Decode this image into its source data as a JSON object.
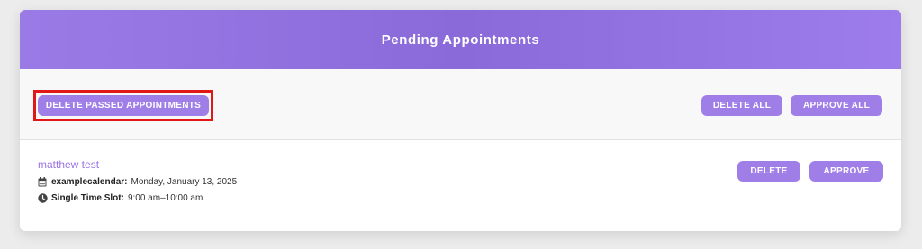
{
  "panel": {
    "title": "Pending Appointments"
  },
  "toolbar": {
    "delete_passed_label": "DELETE PASSED APPOINTMENTS",
    "delete_all_label": "DELETE ALL",
    "approve_all_label": "APPROVE ALL"
  },
  "appointments": [
    {
      "name": "matthew test",
      "calendar_label": "examplecalendar:",
      "date": "Monday, January 13, 2025",
      "slot_label": "Single Time Slot:",
      "time": "9:00 am–10:00 am",
      "delete_label": "DELETE",
      "approve_label": "APPROVE"
    }
  ],
  "colors": {
    "accent": "#a07ee8",
    "header_gradient_start": "#9a7be6",
    "header_gradient_end": "#9d7ceb",
    "highlight": "#e01818",
    "name_link": "#9a74e6"
  },
  "icons": {
    "calendar": "calendar-icon",
    "clock": "clock-icon"
  }
}
